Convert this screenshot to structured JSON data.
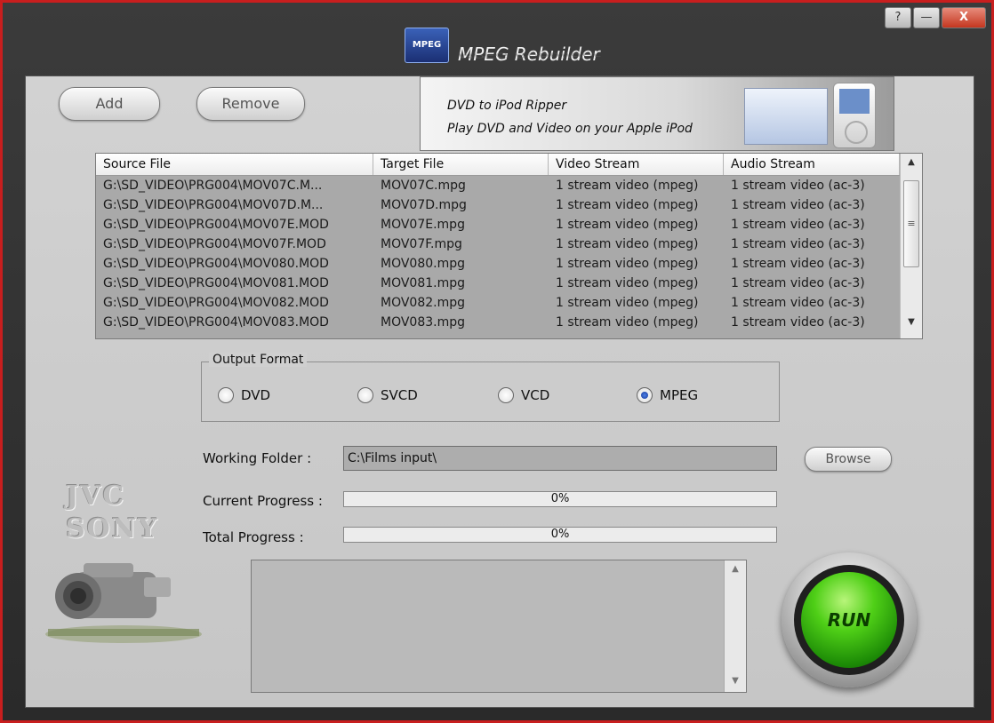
{
  "window": {
    "title": "MPEG Rebuilder",
    "logo_text": "MPEG",
    "help_label": "?",
    "minimize_label": "—",
    "close_label": "X"
  },
  "toolbar": {
    "add_label": "Add",
    "remove_label": "Remove"
  },
  "banner": {
    "line1": "DVD to iPod Ripper",
    "line2": "Play DVD and Video on your Apple iPod"
  },
  "file_table": {
    "columns": [
      "Source File",
      "Target File",
      "Video Stream",
      "Audio Stream"
    ],
    "rows": [
      [
        "G:\\SD_VIDEO\\PRG004\\MOV07C.M...",
        "MOV07C.mpg",
        "1 stream video (mpeg)",
        "1 stream video (ac-3)"
      ],
      [
        "G:\\SD_VIDEO\\PRG004\\MOV07D.M...",
        "MOV07D.mpg",
        "1 stream video (mpeg)",
        "1 stream video (ac-3)"
      ],
      [
        "G:\\SD_VIDEO\\PRG004\\MOV07E.MOD",
        "MOV07E.mpg",
        "1 stream video (mpeg)",
        "1 stream video (ac-3)"
      ],
      [
        "G:\\SD_VIDEO\\PRG004\\MOV07F.MOD",
        "MOV07F.mpg",
        "1 stream video (mpeg)",
        "1 stream video (ac-3)"
      ],
      [
        "G:\\SD_VIDEO\\PRG004\\MOV080.MOD",
        "MOV080.mpg",
        "1 stream video (mpeg)",
        "1 stream video (ac-3)"
      ],
      [
        "G:\\SD_VIDEO\\PRG004\\MOV081.MOD",
        "MOV081.mpg",
        "1 stream video (mpeg)",
        "1 stream video (ac-3)"
      ],
      [
        "G:\\SD_VIDEO\\PRG004\\MOV082.MOD",
        "MOV082.mpg",
        "1 stream video (mpeg)",
        "1 stream video (ac-3)"
      ],
      [
        "G:\\SD_VIDEO\\PRG004\\MOV083.MOD",
        "MOV083.mpg",
        "1 stream video (mpeg)",
        "1 stream video (ac-3)"
      ]
    ]
  },
  "output_format": {
    "legend": "Output Format",
    "options": [
      "DVD",
      "SVCD",
      "VCD",
      "MPEG"
    ],
    "selected": "MPEG"
  },
  "working_folder": {
    "label": "Working Folder :",
    "value": "C:\\Films input\\",
    "browse_label": "Browse"
  },
  "progress": {
    "current_label": "Current Progress :",
    "current_text": "0%",
    "current_value": 0,
    "total_label": "Total Progress :",
    "total_text": "0%",
    "total_value": 0
  },
  "run_label": "RUN",
  "brand": {
    "line1": "JVC",
    "line2": "SONY"
  },
  "colors": {
    "window_border": "#c81e1e",
    "panel_bg": "#cfcfcf",
    "table_bg": "#a9a9a9",
    "run_green": "#3fbf10",
    "radio_selected": "#1f4fc4"
  }
}
